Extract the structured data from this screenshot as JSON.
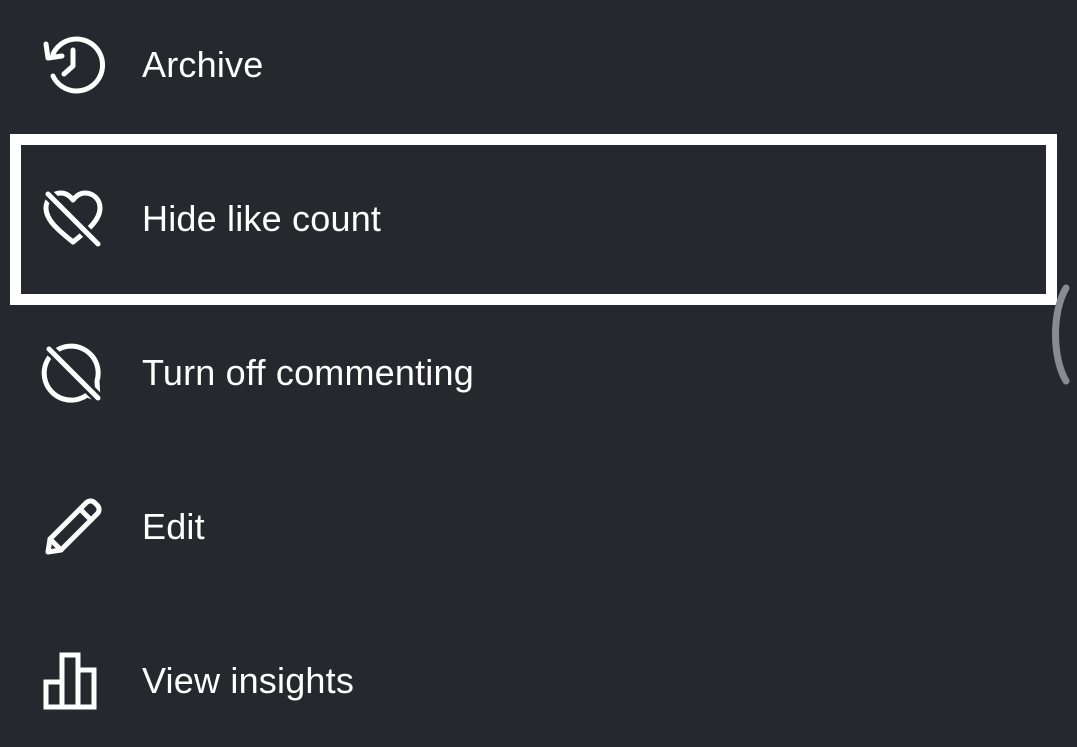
{
  "menu": {
    "items": [
      {
        "label": "Archive",
        "icon": "archive-history-icon"
      },
      {
        "label": "Hide like count",
        "icon": "heart-off-icon"
      },
      {
        "label": "Turn off commenting",
        "icon": "comment-off-icon"
      },
      {
        "label": "Edit",
        "icon": "pencil-icon"
      },
      {
        "label": "View insights",
        "icon": "bar-chart-icon"
      }
    ],
    "highlighted_item": "Hide like count"
  },
  "colors": {
    "background": "#27282d",
    "foreground": "#ffffff",
    "highlight_border": "#ffffff",
    "scroll_handle": "#8a8b90"
  }
}
